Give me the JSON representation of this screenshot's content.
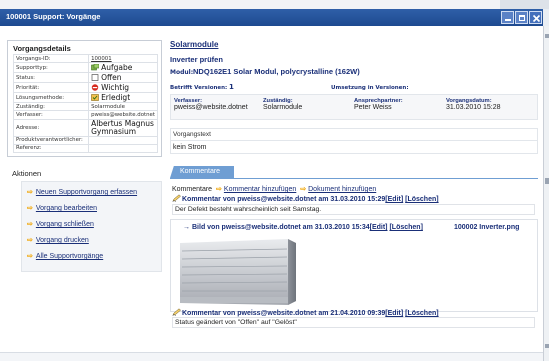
{
  "window": {
    "title": "100001 Support: Vorgänge",
    "buttons": {
      "min_icon": "minimize-icon",
      "max_icon": "maximize-icon",
      "close_icon": "close-icon",
      "close_glyph": "✕"
    }
  },
  "details": {
    "heading": "Vorgangsdetails",
    "rows": [
      {
        "key": "Vorgangs-ID:",
        "value": "100001",
        "link": true
      },
      {
        "key": "Supporttyp:",
        "value": "Aufgabe",
        "icon": "task-icon",
        "big": true
      },
      {
        "key": "Status:",
        "value": "Offen",
        "icon": "checkbox-icon",
        "big": true
      },
      {
        "key": "Priorität:",
        "value": "Wichtig",
        "icon": "priority-icon",
        "big": true
      },
      {
        "key": "Lösungsmethode:",
        "value": "Erledigt",
        "icon": "done-icon",
        "big": true
      },
      {
        "key": "Zuständig:",
        "value": "Solarmodule"
      },
      {
        "key": "Verfasser:",
        "value": "pweiss@website.dotnet"
      },
      {
        "key": "Adresse:",
        "value": "Albertus Magnus Gymnasium",
        "big": true,
        "tall": true
      },
      {
        "key": "Produktverantwortlicher:",
        "value": ""
      },
      {
        "key": "Referenz:",
        "value": ""
      }
    ]
  },
  "actions": {
    "heading": "Aktionen",
    "items": [
      {
        "label": "Neuen Supportvorgang erfassen",
        "name": "action-new-case"
      },
      {
        "label": "Vorgang bearbeiten",
        "name": "action-edit-case"
      },
      {
        "label": "Vorgang schließen",
        "name": "action-close-case"
      },
      {
        "label": "Vorgang drucken",
        "name": "action-print-case"
      },
      {
        "label": "Alle Supportvorgänge",
        "name": "action-all-cases"
      }
    ]
  },
  "case": {
    "title": "Solarmodule",
    "subtitle": "Inverter prüfen",
    "module_label": "Modul:",
    "module_value": "NDQ162E1 Solar Modul, polycrystalline (162W)",
    "version_label": "Betrifft Versionen:",
    "version_value": "1",
    "implementation_label": "Umsetzung in Versionen:",
    "info": {
      "author_label": "Verfasser:",
      "author": "pweiss@website.dotnet",
      "responsible_label": "Zuständig:",
      "responsible": "Solarmodule",
      "contact_label": "Ansprechpartner:",
      "contact": "Peter Weiss",
      "date_label": "Vorgangsdatum:",
      "date": "31.03.2010 15:28"
    },
    "text_label": "Vorgangstext",
    "text_value": "kein Strom"
  },
  "comments": {
    "tab": "Kommentare",
    "bar_prefix": "Kommentare",
    "add_comment": "Kommentar hinzufügen",
    "add_document": "Dokument hinzufügen",
    "edit": "[Edit]",
    "delete": "[Löschen]",
    "items": [
      {
        "head": "Kommentar von pweiss@website.dotnet am 31.03.2010 15:29",
        "body": "Der Defekt besteht wahrscheinlich seit Samstag."
      },
      {
        "head": "Kommentar von pweiss@website.dotnet am 21.04.2010 09:39",
        "body": "Status geändert von \"Offen\" auf \"Gelöst\""
      }
    ],
    "image": {
      "head": "Bild von pweiss@website.dotnet am 31.03.2010 15:34",
      "file": "100002 Inverter.png"
    }
  },
  "colors": {
    "titlebar": "#2563a8",
    "link": "#1a2f78",
    "accent_arrow": "#f0a400",
    "tab": "#6f9ed3"
  }
}
